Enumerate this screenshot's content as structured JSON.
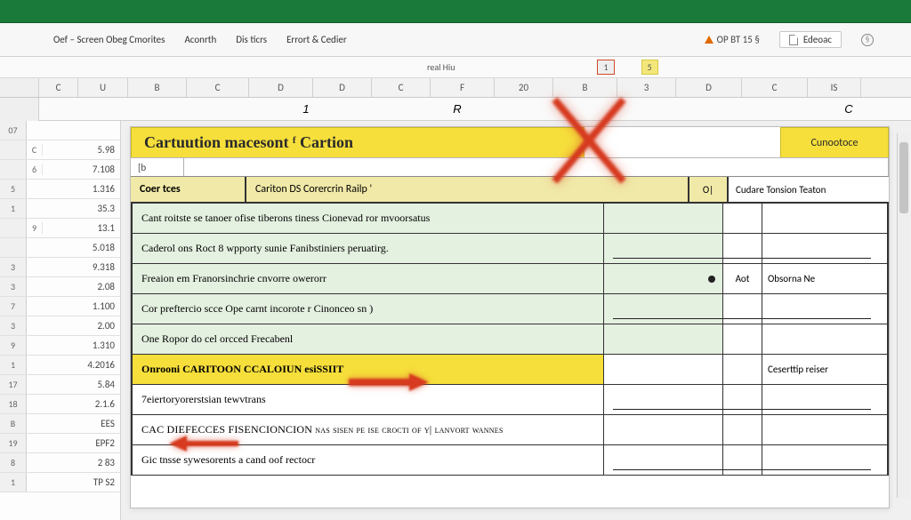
{
  "titlebar": {
    "color": "#1a7a3a"
  },
  "menu": {
    "items": [
      "Oef – Screen Obeg Cmorites",
      "Aconrth",
      "Dis ticrs",
      "Errort & Cedier"
    ],
    "warn_label": "OP BT 15 §",
    "pill_label": "Edeoac",
    "circ_label": "§"
  },
  "strip2": {
    "left": "real Hiu",
    "chip_red": "1",
    "chip_y": "5"
  },
  "column_headers": [
    "C",
    "U",
    "B",
    "C",
    "D",
    "D",
    "C",
    "F",
    "20",
    "B",
    "3",
    "D",
    "C",
    "IS"
  ],
  "fxrow": {
    "l1": "1",
    "l2": "R",
    "l3": "C"
  },
  "left_rows": [
    {
      "rh": "07",
      "c": "",
      "v": ""
    },
    {
      "rh": "",
      "c": "C",
      "v": "5.98"
    },
    {
      "rh": "",
      "c": "6",
      "v": "7.108"
    },
    {
      "rh": "5",
      "c": "",
      "v": "1.316"
    },
    {
      "rh": "1",
      "c": "",
      "v": "35.3"
    },
    {
      "rh": "",
      "c": "9",
      "v": "13.1"
    },
    {
      "rh": "",
      "c": "",
      "v": "5.018"
    },
    {
      "rh": "3",
      "c": "",
      "v": "9.318"
    },
    {
      "rh": "3",
      "c": "",
      "v": "2.08"
    },
    {
      "rh": "7",
      "c": "",
      "v": "1.100"
    },
    {
      "rh": "3",
      "c": "",
      "v": "2.00"
    },
    {
      "rh": "9",
      "c": "",
      "v": "1.310"
    },
    {
      "rh": "1",
      "c": "",
      "v": "4.2016"
    },
    {
      "rh": "17",
      "c": "",
      "v": "5.84"
    },
    {
      "rh": "18",
      "c": "",
      "v": "2.1.6"
    },
    {
      "rh": "B",
      "c": "",
      "v": "EES"
    },
    {
      "rh": "19",
      "c": "",
      "v": "EPF2"
    },
    {
      "rh": "8",
      "c": "",
      "v": "2 83"
    },
    {
      "rh": "1",
      "c": "",
      "v": "TP S2"
    }
  ],
  "doc": {
    "title_main": "Cartuution macesont ᶠ Cartion",
    "title_right": "Cunootoce",
    "sub1_a": "[b",
    "headers": {
      "h1": "Coer tces",
      "h2": "Cariton DS Corercrin Railp '",
      "h3": "O|",
      "h4": "Cudare Tonsion Teaton"
    },
    "rows": [
      {
        "t": "Cant roitste se tanoer ofise tiberons tiness Cionevad ror mvoorsatus",
        "m": "",
        "s1": "",
        "s2": "",
        "underline": false,
        "greenish": true
      },
      {
        "t": "Caderol ons Roct 8 wpporty sunie Fanibstiniers peruatirg.",
        "m": "",
        "s1": "",
        "s2": "",
        "underline": true,
        "greenish": true
      },
      {
        "t": "Freaion em Franorsinchrie cnvorre owerorr",
        "m": "",
        "s1": "Aot",
        "s2": "Obsorna Ne",
        "underline": false,
        "greenish": true,
        "dot": true
      },
      {
        "t": "Cor preftercio scce Ope carnt incorote r Cinonceo sn )",
        "m": "",
        "s1": "",
        "s2": "",
        "underline": true,
        "greenish": true
      },
      {
        "t": "One Ropor do cel orcced Frecabenl",
        "m": "",
        "s1": "",
        "s2": "",
        "underline": false,
        "greenish": true
      },
      {
        "t": "Onrooni CARITOON CCALOIUN esiSSIIT",
        "m": "",
        "s1": "",
        "s2": "Ceserttip reiser",
        "underline": false,
        "highlight": true
      },
      {
        "t": "7eiertoryorerstsian tewvtrans",
        "m": "",
        "s1": "",
        "s2": "",
        "underline": true,
        "greenish": false
      },
      {
        "t": "CAC    DIEFECCES   FISENCIONCION          nas sisen pe    ise crocti of y| lanvort wannes",
        "m": "",
        "s1": "",
        "s2": "",
        "underline": false,
        "greenish": false,
        "smallcaps": true
      },
      {
        "t": "Gic tnsse sywesorents a cand oof rectocr",
        "m": "",
        "s1": "",
        "s2": "",
        "underline": true,
        "greenish": false
      }
    ]
  },
  "icons": {
    "warn": "warning-triangle",
    "doc": "document-icon",
    "share": "share-icon"
  }
}
